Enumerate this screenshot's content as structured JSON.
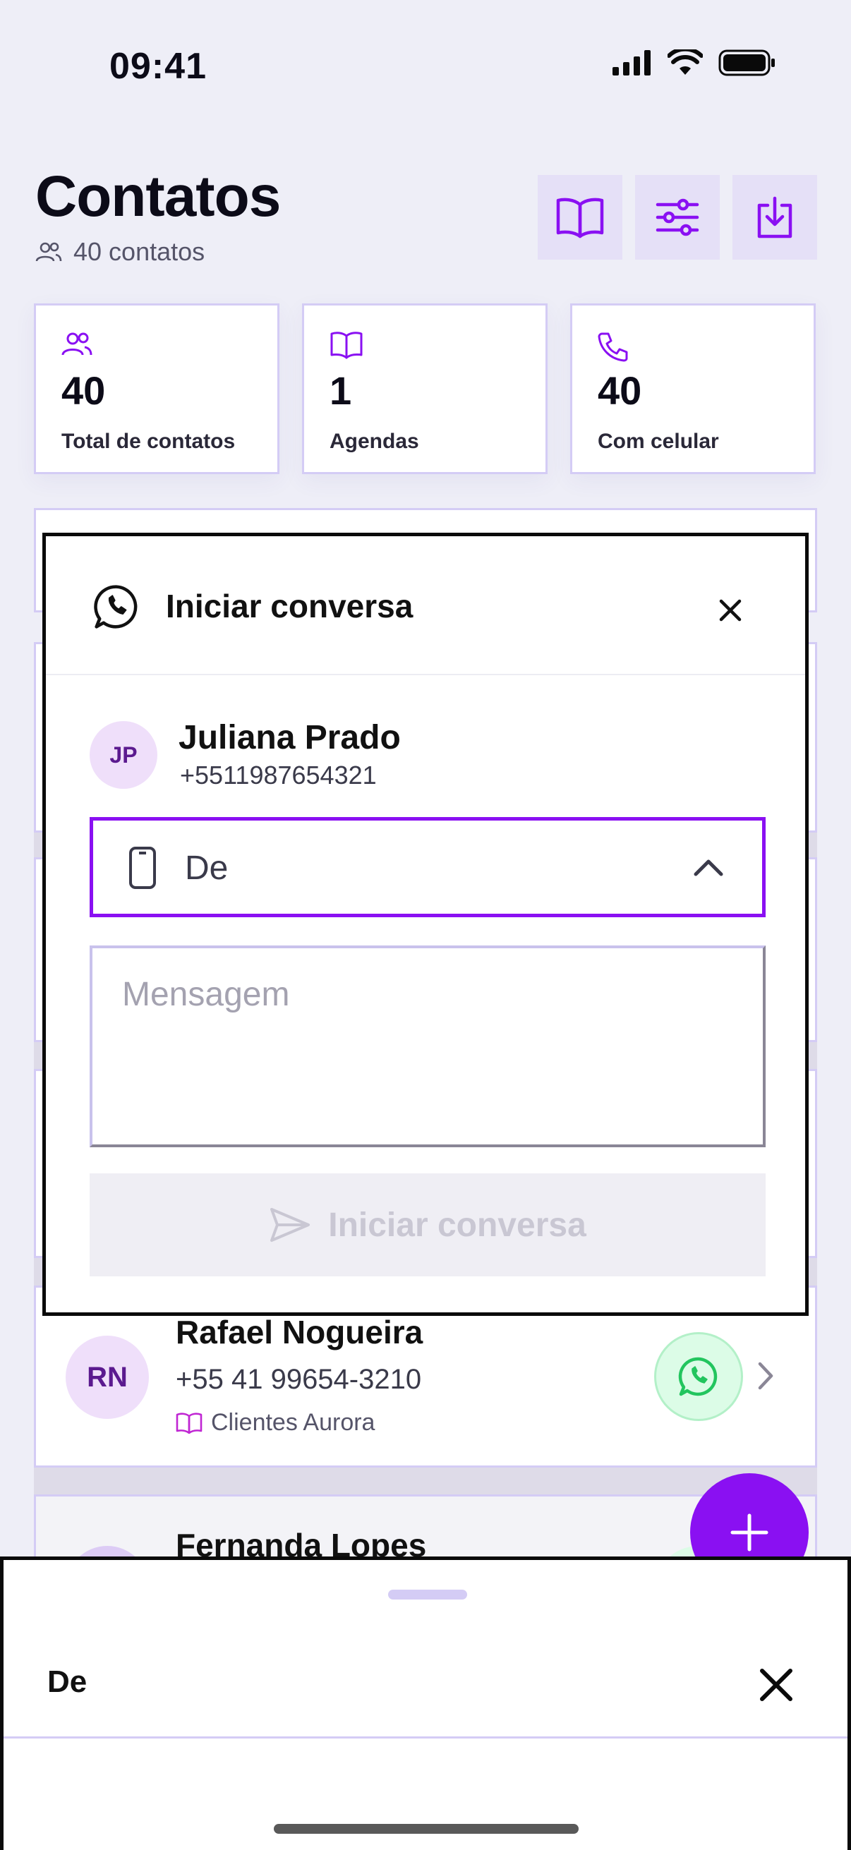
{
  "status_bar": {
    "time": "09:41"
  },
  "header": {
    "title": "Contatos",
    "count_label": "40 contatos",
    "actions": [
      {
        "name": "agendas-button",
        "icon": "book-open-icon"
      },
      {
        "name": "filters-button",
        "icon": "sliders-icon"
      },
      {
        "name": "import-button",
        "icon": "download-icon"
      }
    ]
  },
  "stats": [
    {
      "value": "40",
      "label": "Total de contatos",
      "icon": "users-icon"
    },
    {
      "value": "1",
      "label": "Agendas",
      "icon": "book-open-icon"
    },
    {
      "value": "40",
      "label": "Com celular",
      "icon": "phone-icon"
    }
  ],
  "contacts_behind": [
    {
      "initials": "RN",
      "name": "Rafael Nogueira",
      "phone": "+55 41 99654-3210",
      "agenda": "Clientes Aurora"
    },
    {
      "name": "Fernanda Lopes"
    }
  ],
  "modal": {
    "title": "Iniciar conversa",
    "contact": {
      "initials": "JP",
      "name": "Juliana Prado",
      "phone": "+5511987654321"
    },
    "from_select": {
      "label": "De",
      "expanded": true
    },
    "message": {
      "placeholder": "Mensagem",
      "value": ""
    },
    "submit_label": "Iniciar conversa"
  },
  "sheet": {
    "title": "De"
  },
  "colors": {
    "accent": "#8a10f2",
    "background": "#eeeef7",
    "whatsapp_green": "#22c55e"
  }
}
